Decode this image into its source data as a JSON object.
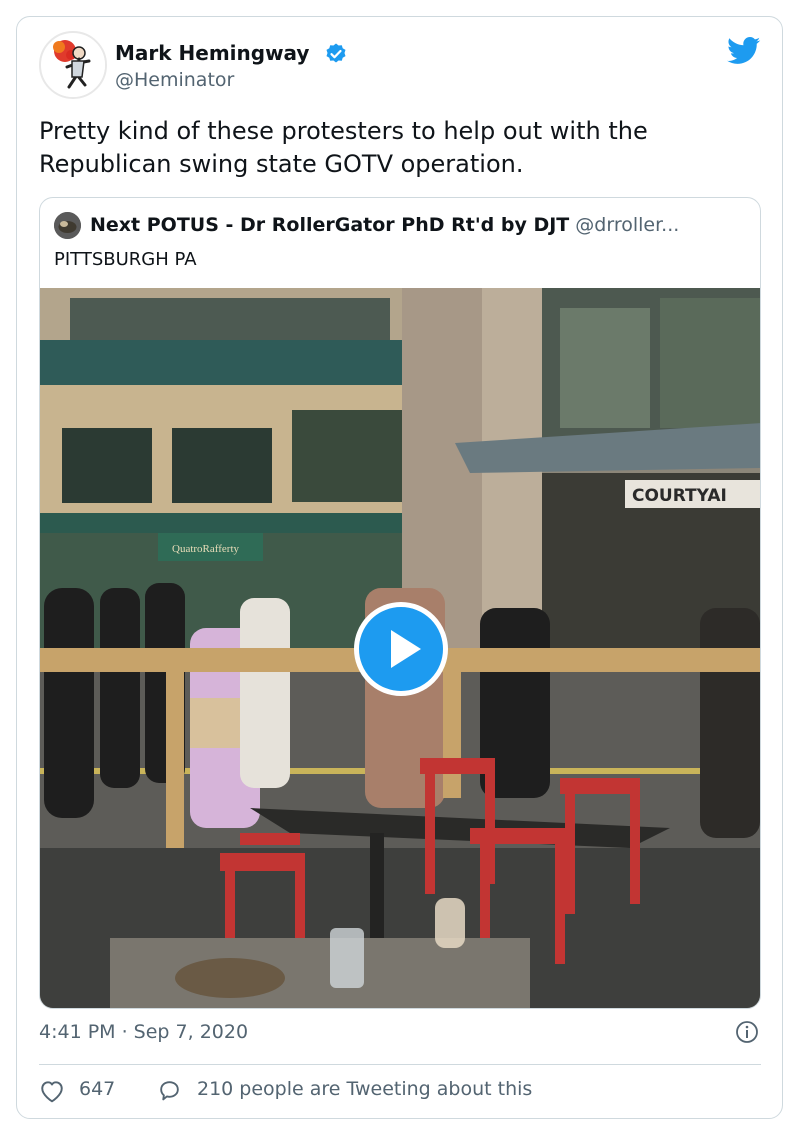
{
  "author": {
    "name": "Mark Hemingway",
    "handle": "@Heminator"
  },
  "tweet": {
    "text": "Pretty kind of these protesters to help out with the Republican swing state GOTV operation.",
    "timestamp": "4:41 PM · Sep 7, 2020"
  },
  "quoted": {
    "author_name": "Next POTUS - Dr RollerGator PhD Rt'd by DJT",
    "author_handle": "@drroller...",
    "text": "PITTSBURGH PA"
  },
  "media": {
    "sign_storefront": "QuatroRafferty",
    "sign_courtyard": "COURTYAI"
  },
  "engagement": {
    "likes": "647",
    "reply_text": "210 people are Tweeting about this"
  },
  "colors": {
    "accent": "#1d9bf0",
    "secondary_text": "#536471",
    "border": "#cfd9de"
  },
  "icons": {
    "verified": "verified-badge-icon",
    "brand": "twitter-bird-icon",
    "info": "info-icon",
    "like": "heart-icon",
    "reply": "speech-bubble-icon",
    "play": "play-icon"
  }
}
